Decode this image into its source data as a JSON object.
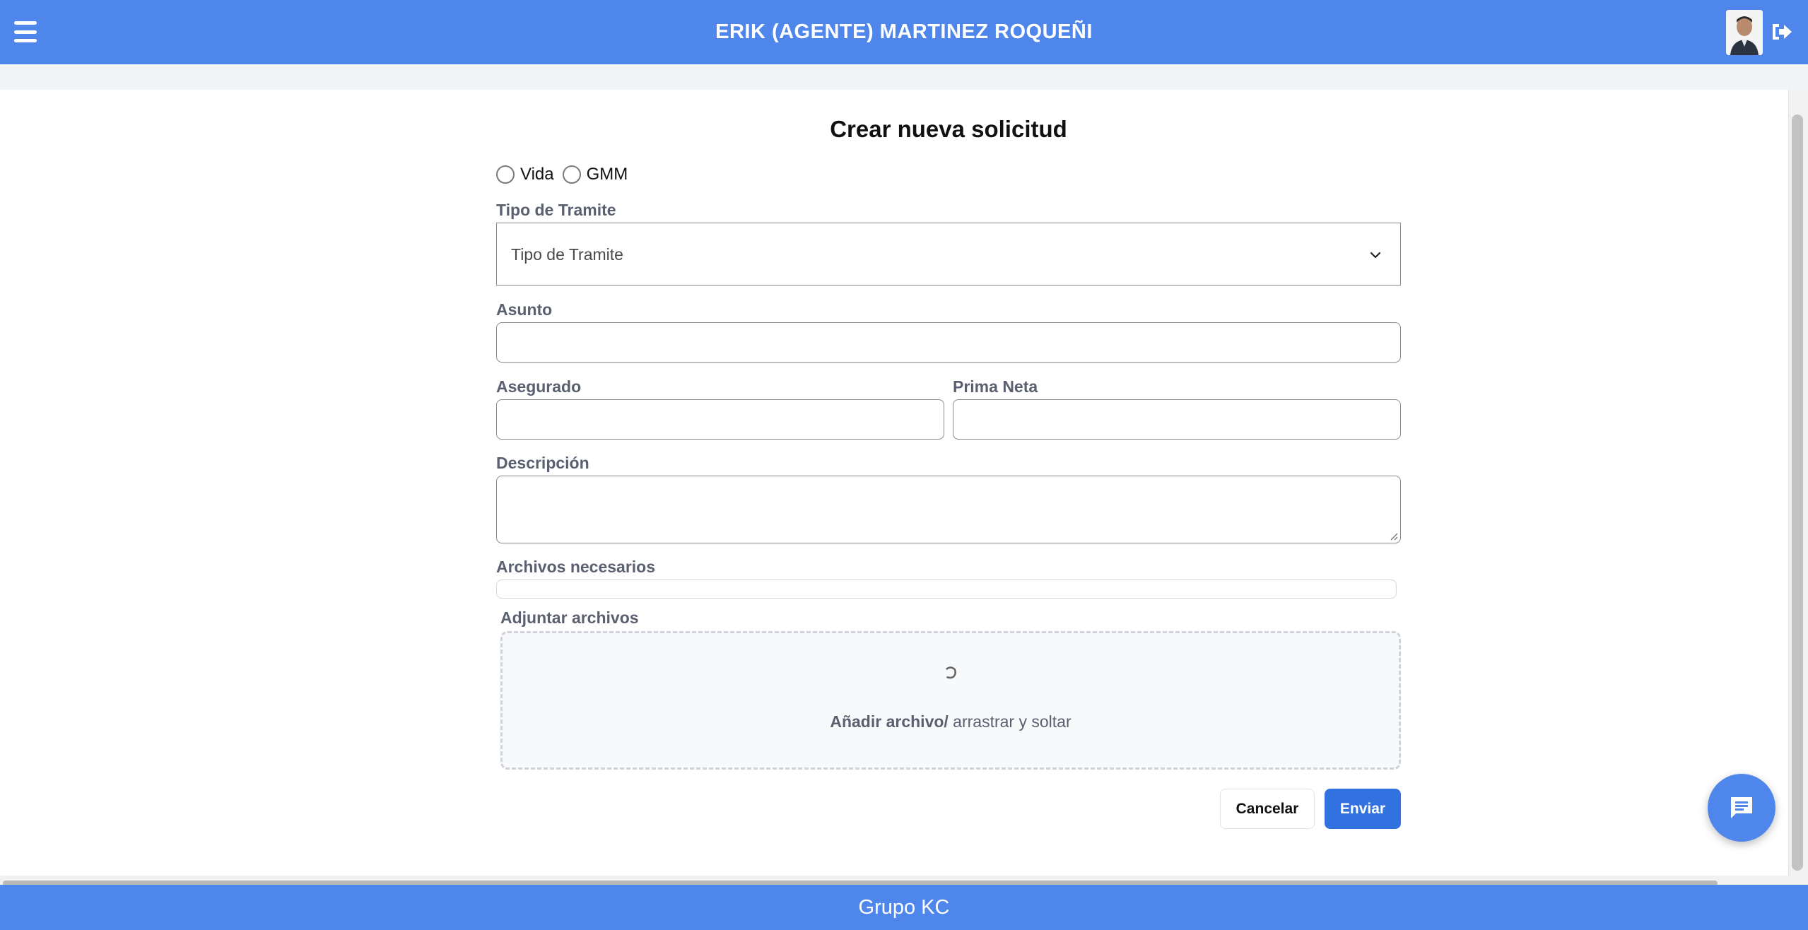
{
  "header": {
    "user_name": "ERIK (AGENTE) MARTINEZ ROQUEÑI",
    "menu_icon": "hamburger-menu-icon",
    "logout_icon": "logout-icon"
  },
  "form": {
    "title": "Crear nueva solicitud",
    "radio_options": [
      "Vida",
      "GMM"
    ],
    "tipo_tramite": {
      "label": "Tipo de Tramite",
      "selected_value": "Tipo de Tramite"
    },
    "asunto": {
      "label": "Asunto",
      "value": ""
    },
    "asegurado": {
      "label": "Asegurado",
      "value": ""
    },
    "prima_neta": {
      "label": "Prima Neta",
      "value": ""
    },
    "descripcion": {
      "label": "Descripción",
      "value": ""
    },
    "archivos_necesarios": {
      "label": "Archivos necesarios"
    },
    "adjuntar": {
      "label": "Adjuntar archivos",
      "action_text": "Añadir archivo/",
      "hint_text": " arrastrar y soltar"
    },
    "buttons": {
      "cancel": "Cancelar",
      "submit": "Enviar"
    }
  },
  "footer": {
    "text": "Grupo KC"
  },
  "colors": {
    "primary": "#4f86ec",
    "button_primary": "#3272e0",
    "label": "#5b6070"
  }
}
